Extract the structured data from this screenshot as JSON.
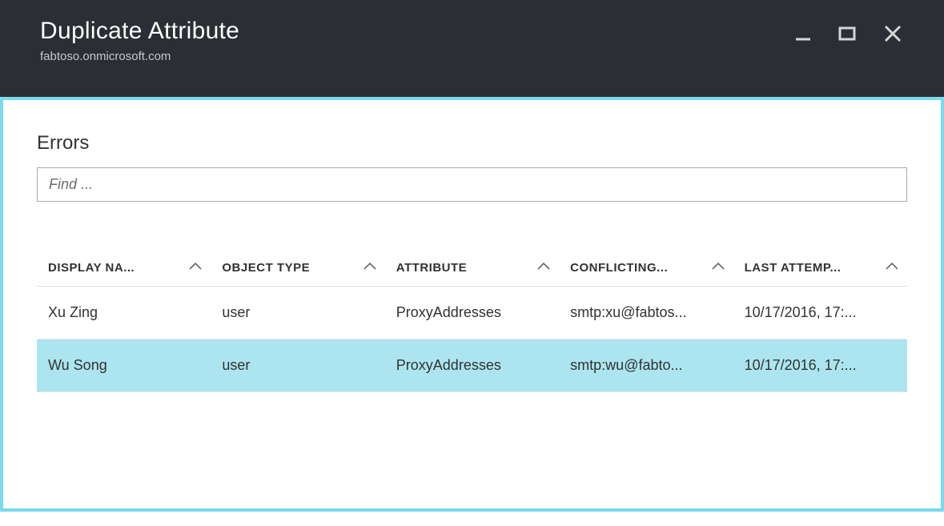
{
  "header": {
    "title": "Duplicate Attribute",
    "subtitle": "fabtoso.onmicrosoft.com"
  },
  "section": {
    "title": "Errors",
    "search_placeholder": "Find ..."
  },
  "table": {
    "columns": [
      {
        "label": "DISPLAY NA..."
      },
      {
        "label": "OBJECT TYPE"
      },
      {
        "label": "ATTRIBUTE"
      },
      {
        "label": "CONFLICTING..."
      },
      {
        "label": "LAST ATTEMP..."
      }
    ],
    "rows": [
      {
        "display_name": "Xu Zing",
        "object_type": "user",
        "attribute": "ProxyAddresses",
        "conflicting": "smtp:xu@fabtos...",
        "last_attempt": "10/17/2016, 17:..."
      },
      {
        "display_name": "Wu Song",
        "object_type": "user",
        "attribute": "ProxyAddresses",
        "conflicting": "smtp:wu@fabto...",
        "last_attempt": "10/17/2016, 17:..."
      }
    ],
    "selected_index": 1
  }
}
